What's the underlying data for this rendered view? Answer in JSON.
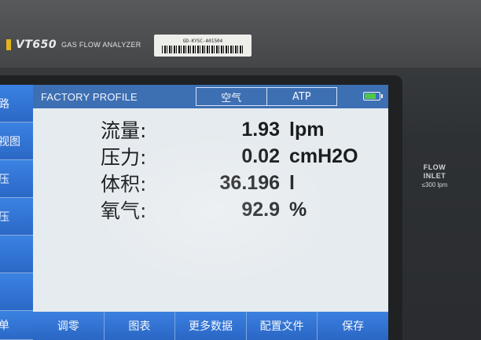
{
  "device": {
    "model": "VT650",
    "description": "GAS FLOW ANALYZER",
    "serial": "GD-KYSC-A01504"
  },
  "screen": {
    "profile_title": "FACTORY PROFILE",
    "gas_tabs": [
      "空气",
      "ATP"
    ],
    "battery_level": 0.8,
    "battery_color": "#4fc84a"
  },
  "readings": [
    {
      "label": "流量:",
      "value": "1.93",
      "unit": "lpm"
    },
    {
      "label": "压力:",
      "value": "0.02",
      "unit": "cmH2O"
    },
    {
      "label": "体积:",
      "value": "36.196",
      "unit": "l"
    },
    {
      "label": "氧气:",
      "value": "92.9",
      "unit": "%"
    }
  ],
  "softkeys": [
    "调零",
    "图表",
    "更多数据",
    "配置文件",
    "保存"
  ],
  "side_menu": [
    "路",
    "视图",
    "压",
    "压",
    "",
    "",
    "单"
  ],
  "inlet_label": {
    "line1": "FLOW",
    "line2": "INLET",
    "line3": "≤300 lpm"
  },
  "colors": {
    "title_bar": "#3d6fb3",
    "softkey_blue": "#2f6fd0",
    "screen_bg": "#e6ebef",
    "accent_yellow": "#e2b31a"
  }
}
